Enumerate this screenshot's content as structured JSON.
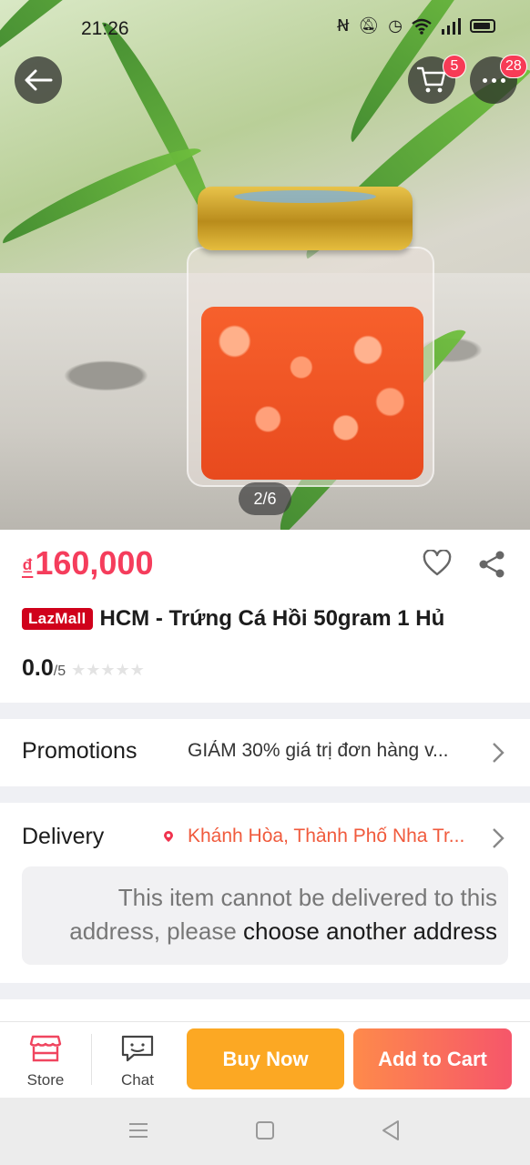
{
  "status_bar": {
    "time": "21:26"
  },
  "header": {
    "cart_badge": "5",
    "more_badge": "28"
  },
  "gallery": {
    "pager": "2/6"
  },
  "product": {
    "currency": "₫",
    "price": "160,000",
    "mall_badge": "LazMall",
    "title": "HCM - Trứng Cá Hồi 50gram  1 Hủ",
    "rating": "0.0",
    "rating_max": "/5",
    "stars": "★★★★★"
  },
  "promotions": {
    "label": "Promotions",
    "value": "GIẢM 30% giá trị đơn hàng v..."
  },
  "delivery": {
    "label": "Delivery",
    "location": "Khánh Hòa, Thành Phố Nha Tr...",
    "warning_text": "This item cannot be delivered to this address, please ",
    "warning_link": "choose another address"
  },
  "action_bar": {
    "store_label": "Store",
    "chat_label": "Chat",
    "buy_now": "Buy Now",
    "add_to_cart": "Add to Cart"
  },
  "colors": {
    "price": "#f53d5c",
    "lazmall": "#d0011b",
    "buy_now": "#fca823",
    "add_to_cart_start": "#fe8a4b",
    "add_to_cart_end": "#f6566a",
    "delivery_location": "#f05a3c"
  },
  "icons": [
    "back-arrow-icon",
    "cart-icon",
    "more-icon",
    "heart-icon",
    "share-icon",
    "chevron-right-icon",
    "location-pin-icon",
    "store-icon",
    "chat-icon",
    "menu-icon",
    "home-icon",
    "back-icon"
  ]
}
